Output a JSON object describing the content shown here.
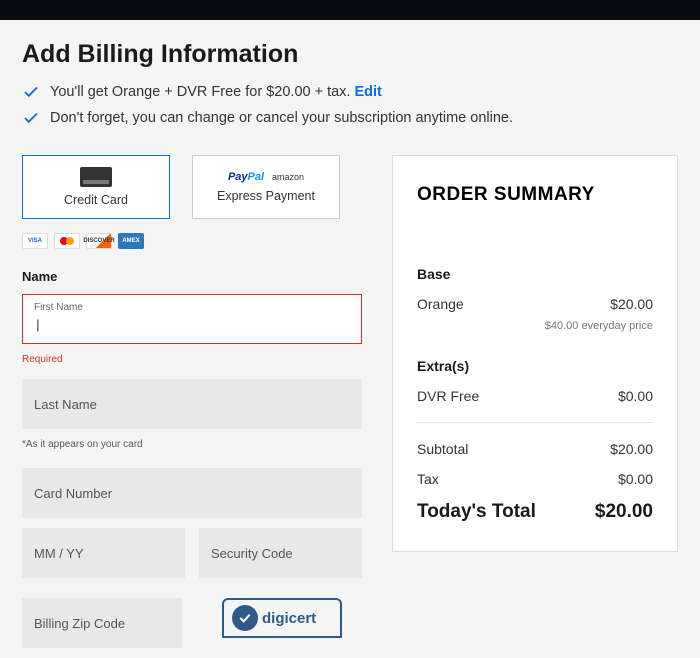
{
  "page": {
    "title": "Add Billing Information",
    "info1_prefix": "You'll get Orange + DVR Free for $20.00 + tax. ",
    "info1_edit": "Edit",
    "info2": "Don't forget, you can change or cancel your subscription anytime online."
  },
  "payment_tabs": {
    "credit_card": "Credit Card",
    "express": "Express Payment",
    "paypal_p": "Pay",
    "paypal_pal": "Pal",
    "amazon": "amazon"
  },
  "card_brands": {
    "visa": "VISA",
    "discover": "DISCOVER",
    "amex": "AMEX"
  },
  "form": {
    "name_label": "Name",
    "first_name_label": "First Name",
    "first_name_value": "",
    "required_error": "Required",
    "last_name_placeholder": "Last Name",
    "appears_note": "*As it appears on your card",
    "card_number_placeholder": "Card Number",
    "expiry_placeholder": "MM / YY",
    "security_placeholder": "Security Code",
    "zip_placeholder": "Billing Zip Code"
  },
  "digicert": "digicert",
  "summary": {
    "title": "ORDER SUMMARY",
    "base_label": "Base",
    "base_item": "Orange",
    "base_price": "$20.00",
    "everyday_note": "$40.00 everyday price",
    "extras_label": "Extra(s)",
    "extras_item": "DVR Free",
    "extras_price": "$0.00",
    "subtotal_label": "Subtotal",
    "subtotal_value": "$20.00",
    "tax_label": "Tax",
    "tax_value": "$0.00",
    "total_label": "Today's Total",
    "total_value": "$20.00"
  }
}
